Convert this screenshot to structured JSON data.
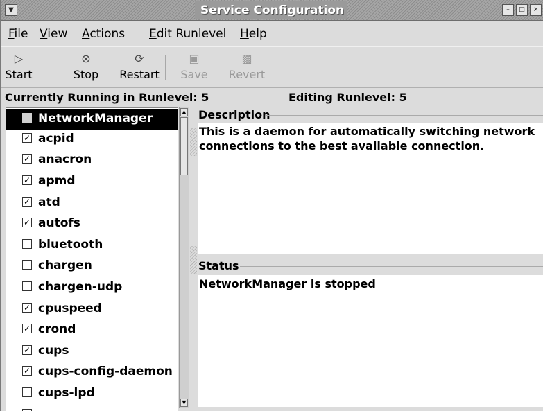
{
  "window": {
    "title": "Service Configuration"
  },
  "menu": [
    {
      "label": "File",
      "mnemonic": "F",
      "rest": "ile"
    },
    {
      "label": "View",
      "mnemonic": "V",
      "rest": "iew"
    },
    {
      "label": "Actions",
      "mnemonic": "A",
      "rest": "ctions"
    },
    {
      "label": "Edit Runlevel",
      "mnemonic": "E",
      "rest": "dit Runlevel"
    },
    {
      "label": "Help",
      "mnemonic": "H",
      "rest": "elp"
    }
  ],
  "toolbar": {
    "start": {
      "label": "Start",
      "icon": "play-icon"
    },
    "stop": {
      "label": "Stop",
      "icon": "stop-icon"
    },
    "restart": {
      "label": "Restart",
      "icon": "restart-icon"
    },
    "save": {
      "label": "Save",
      "icon": "save-icon",
      "enabled": false
    },
    "revert": {
      "label": "Revert",
      "icon": "revert-icon",
      "enabled": false
    }
  },
  "runlevel": {
    "running": "Currently Running in Runlevel: 5",
    "editing": "Editing Runlevel: 5"
  },
  "services": [
    {
      "name": "NetworkManager",
      "checked": false,
      "selected": true
    },
    {
      "name": "acpid",
      "checked": true
    },
    {
      "name": "anacron",
      "checked": true
    },
    {
      "name": "apmd",
      "checked": true
    },
    {
      "name": "atd",
      "checked": true
    },
    {
      "name": "autofs",
      "checked": true
    },
    {
      "name": "bluetooth",
      "checked": false
    },
    {
      "name": "chargen",
      "checked": false
    },
    {
      "name": "chargen-udp",
      "checked": false
    },
    {
      "name": "cpuspeed",
      "checked": true
    },
    {
      "name": "crond",
      "checked": true
    },
    {
      "name": "cups",
      "checked": true
    },
    {
      "name": "cups-config-daemon",
      "checked": true
    },
    {
      "name": "cups-lpd",
      "checked": false
    }
  ],
  "description": {
    "header": "Description",
    "text": "This is a daemon for automatically switching network connections to the best available connection."
  },
  "status": {
    "header": "Status",
    "text": "NetworkManager is stopped"
  }
}
